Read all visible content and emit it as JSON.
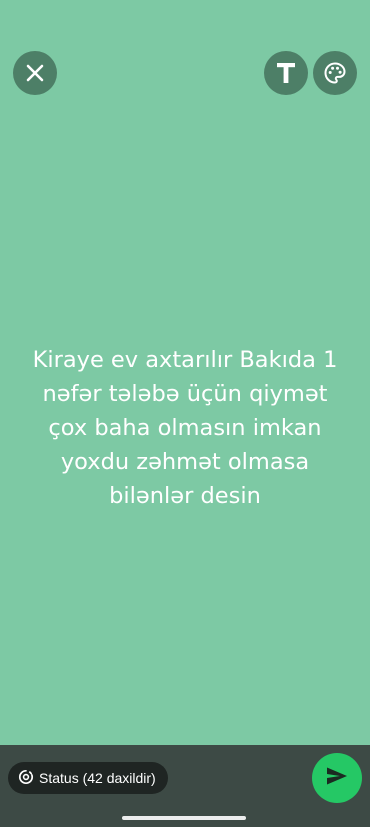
{
  "toolbar": {
    "close_icon": "close-icon",
    "text_icon": "text-format-icon",
    "text_label": "T",
    "palette_icon": "palette-icon"
  },
  "status": {
    "text": "Kiraye ev axtarılır Bakıda 1 nəfər tələbə üçün qiymət çox baha olmasın imkan yoxdu zəhmət olmasa bilənlər desin",
    "background_color": "#7dc9a4",
    "text_color": "#ffffff"
  },
  "footer": {
    "audience_label": "Status (42 daxildir)",
    "audience_icon": "status-ring-icon",
    "send_icon": "send-icon",
    "send_color": "#25c865"
  }
}
